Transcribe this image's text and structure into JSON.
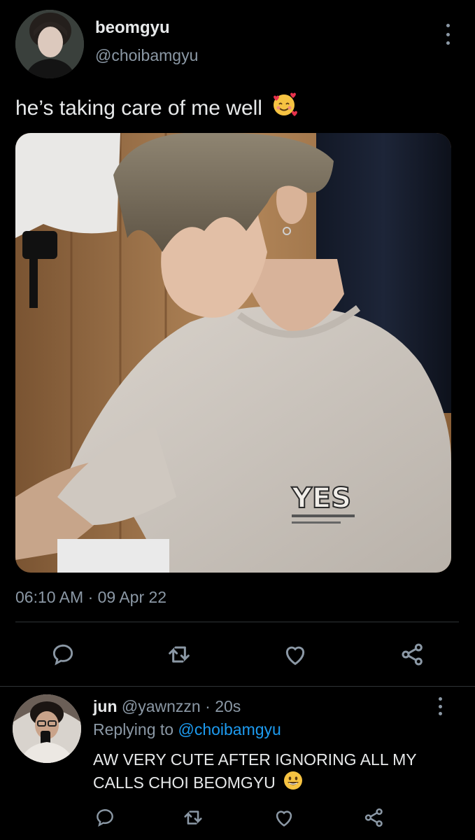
{
  "tweet": {
    "display_name": "beomgyu",
    "handle": "@choibamgyu",
    "text": "he’s taking care of me well",
    "emoji_icon": "smiling-face-with-hearts-icon",
    "timestamp": "06:10 AM · 09 Apr 22",
    "actions": [
      "reply-icon",
      "retweet-icon",
      "like-icon",
      "share-icon"
    ]
  },
  "reply": {
    "display_name": "jun",
    "handle": "@yawnzzn",
    "separator": " · ",
    "time": "20s",
    "replying_prefix": "Replying to ",
    "replying_to": "@choibamgyu",
    "text": "AW VERY CUTE AFTER IGNORING ALL MY CALLS CHOI BEOMGYU",
    "emoji_icon": "grinning-face-icon",
    "actions": [
      "reply-icon",
      "retweet-icon",
      "like-icon",
      "share-icon"
    ]
  },
  "photo": {
    "shirt_print": "YES"
  },
  "colors": {
    "background": "#000000",
    "text": "#e7e9ea",
    "secondary": "#8b98a5",
    "link": "#1d9bf0",
    "divider": "#2f3336"
  }
}
